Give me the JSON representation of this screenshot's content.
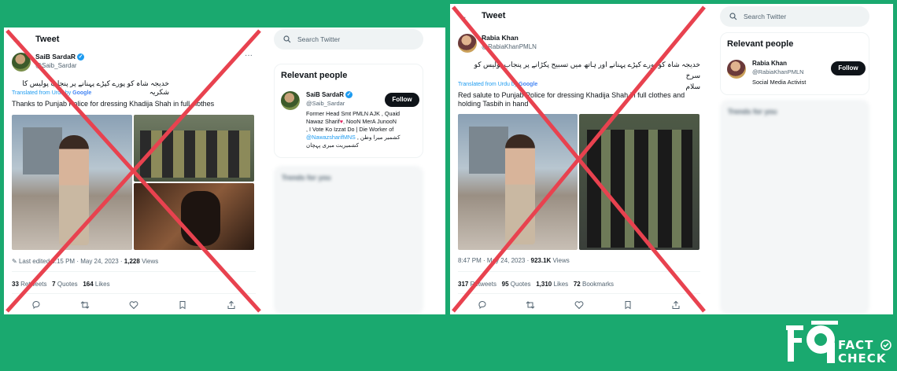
{
  "left_tweet": {
    "header": "Tweet",
    "author_name": "SaiB SardaR",
    "author_handle": "@Saib_Sardar",
    "more_menu": "···",
    "urdu_text": "خدیجہ شاہ کو پورے کپڑے پہنانے پر پنجاب پولیس کا شکریہ",
    "translated_label": "Translated from Urdu by",
    "google": "Google",
    "text": "Thanks to Punjab Police for dressing Khadija Shah in full clothes",
    "meta": "Last edited 5:15 PM · May 24, 2023 · ",
    "views_count": "1,228",
    "views_label": "Views",
    "retweets_count": "33",
    "retweets_label": "Retweets",
    "quotes_count": "7",
    "quotes_label": "Quotes",
    "likes_count": "164",
    "likes_label": "Likes",
    "search_placeholder": "Search Twitter",
    "relevant_people_title": "Relevant people",
    "rp_name": "SaiB SardaR",
    "rp_handle": "@Saib_Sardar",
    "follow_label": "Follow",
    "bio_line1": "Former Head Smt PMLN AJK , Quaid",
    "bio_line2": "Nawaz Sharif",
    "bio_line2b": ", NooN MerA JunooN",
    "bio_line3": ", I Vote Ko Izzat Do | Die Worker of",
    "bio_mention": "@NawazsharifMNS",
    "bio_line4": " , کشمیر میرا وطن",
    "bio_line5": "کشمیریت میری پہچان",
    "trends_title": "Trends for you"
  },
  "right_tweet": {
    "header": "Tweet",
    "author_name": "Rabia Khan",
    "author_handle": "@RabiaKhanPMLN",
    "urdu_text_line1": "خدیجہ شاہ کو پورے کپڑے پہنانے اور ہاتھ میں تسبیح پکڑانے پر پنجاب پولیس کو سرخ",
    "urdu_text_line2": "سلام",
    "translated_label": "Translated from Urdu by",
    "google": "Google",
    "text_line1": "Red salute to Punjab Police for dressing Khadija Shah in full clothes and",
    "text_line2": "holding Tasbih in hand",
    "meta": "8:47 PM · May 24, 2023 · ",
    "views_count": "923.1K",
    "views_label": "Views",
    "retweets_count": "317",
    "retweets_label": "Retweets",
    "quotes_count": "95",
    "quotes_label": "Quotes",
    "likes_count": "1,310",
    "likes_label": "Likes",
    "bookmarks_count": "72",
    "bookmarks_label": "Bookmarks",
    "search_placeholder": "Search Twitter",
    "relevant_people_title": "Relevant people",
    "rp_name": "Rabia Khan",
    "rp_handle": "@RabiaKhanPMLN",
    "rp_bio": "Social Media Activist",
    "follow_label": "Follow",
    "trends_title": "Trends for you"
  },
  "brand": {
    "fact": "FACT",
    "check": "CHECK"
  },
  "colors": {
    "background": "#1aa96f",
    "cross": "#e8424f",
    "twitter_blue": "#1d9bf0"
  }
}
